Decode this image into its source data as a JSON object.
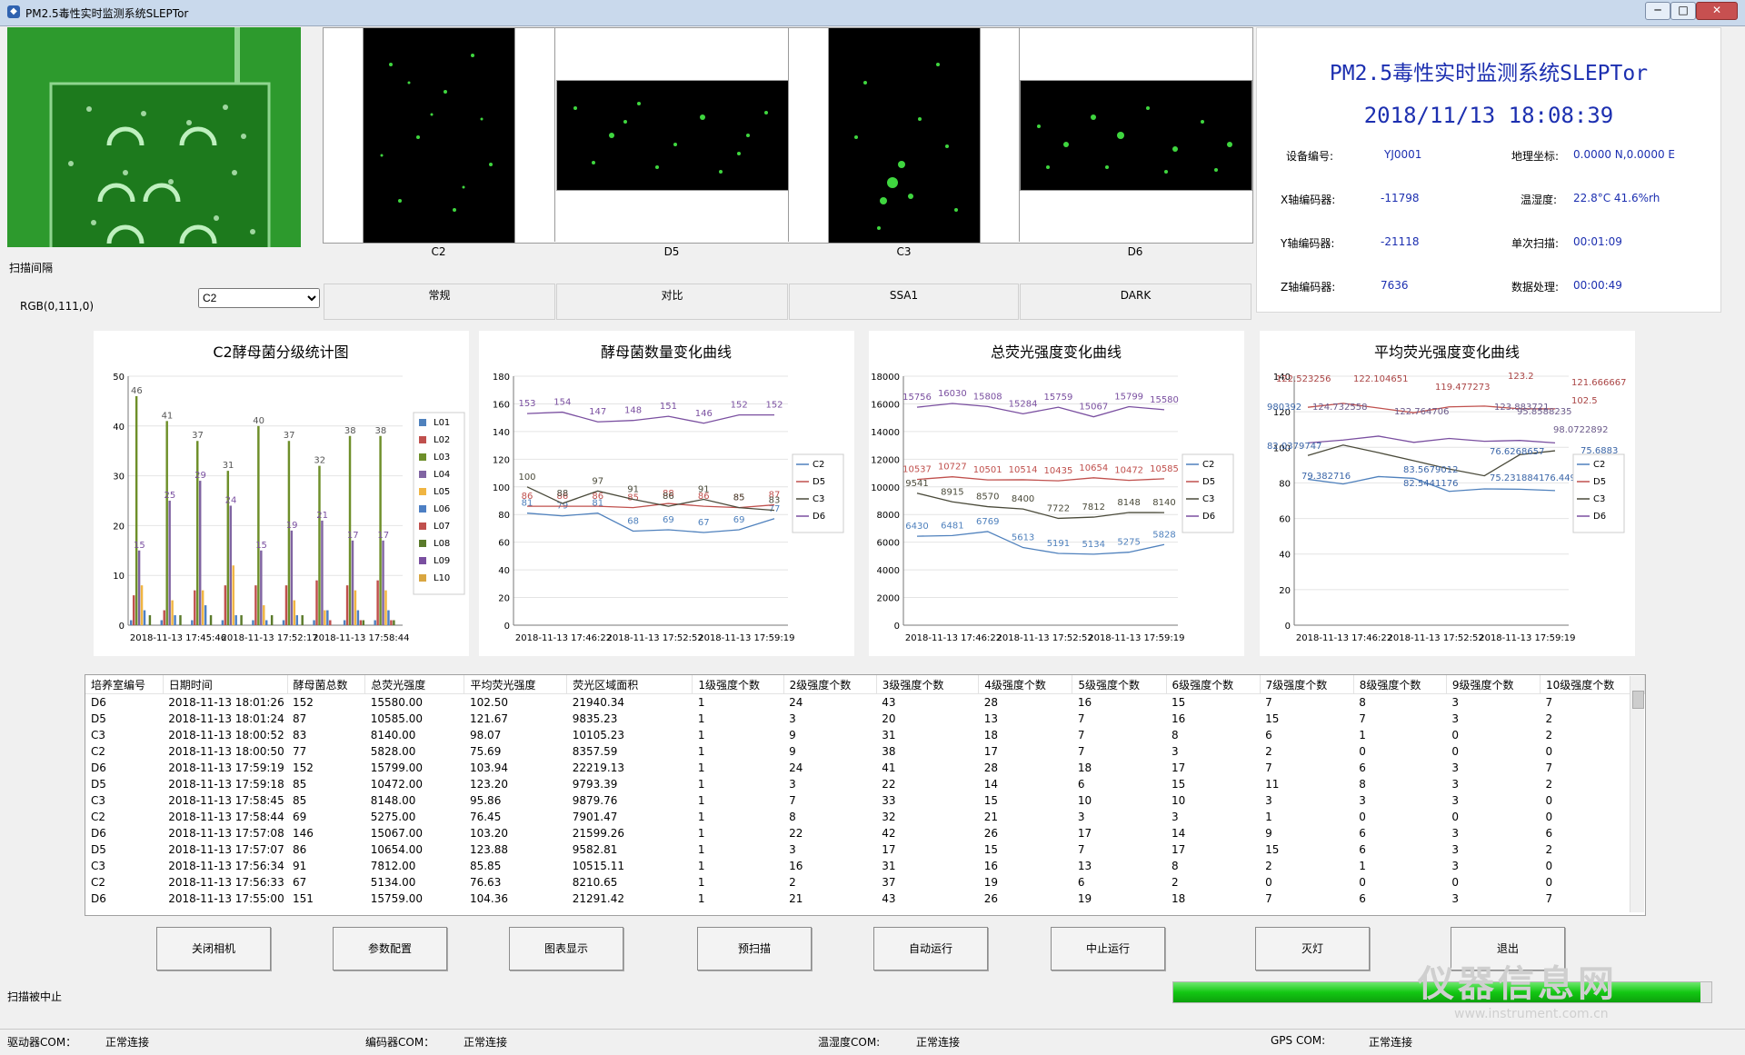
{
  "window": {
    "title": "PM2.5毒性实时监测系统SLEPTor",
    "minimize": "─",
    "maximize": "□",
    "close": "✕"
  },
  "left": {
    "scan_interval_label": "扫描间隔",
    "rgb_label": "RGB(0,111,0)",
    "channel_select": "C2"
  },
  "panels": [
    {
      "caption": "C2"
    },
    {
      "caption": "D5"
    },
    {
      "caption": "C3"
    },
    {
      "caption": "D6"
    }
  ],
  "modes": [
    "常规",
    "对比",
    "SSA1",
    "DARK"
  ],
  "info": {
    "title": "PM2.5毒性实时监测系统SLEPTor",
    "datetime": "2018/11/13  18:08:39",
    "fields": [
      {
        "label": "设备编号:",
        "value": "YJ0001"
      },
      {
        "label": "地理坐标:",
        "value": "0.0000 N,0.0000 E"
      },
      {
        "label": "X轴编码器:",
        "value": "-11798"
      },
      {
        "label": "温湿度:",
        "value": "22.8°C 41.6%rh"
      },
      {
        "label": "Y轴编码器:",
        "value": "-21118"
      },
      {
        "label": "单次扫描:",
        "value": "00:01:09"
      },
      {
        "label": "Z轴编码器:",
        "value": "7636"
      },
      {
        "label": "数据处理:",
        "value": "00:00:49"
      }
    ]
  },
  "chart_data": [
    {
      "type": "bar",
      "title": "C2酵母菌分级统计图",
      "ylim": [
        0,
        50
      ],
      "yticks": [
        0,
        10,
        20,
        30,
        40,
        50
      ],
      "xticklabels": [
        "2018-11-13 17:45:46",
        "2018-11-13 17:52:17",
        "2018-11-13 17:58:44"
      ],
      "legend_position": "right",
      "series": [
        {
          "name": "L01",
          "color": "#4f81bd",
          "values": [
            1,
            1,
            1,
            1,
            1,
            1,
            1,
            1,
            1
          ]
        },
        {
          "name": "L02",
          "color": "#c0504d",
          "values": [
            6,
            3,
            7,
            8,
            8,
            8,
            9,
            8,
            9
          ]
        },
        {
          "name": "L03",
          "color": "#6e8f2a",
          "values": [
            46,
            41,
            37,
            31,
            40,
            37,
            32,
            38,
            38
          ]
        },
        {
          "name": "L04",
          "color": "#8064a2",
          "values": [
            15,
            25,
            29,
            24,
            15,
            19,
            21,
            17,
            17
          ]
        },
        {
          "name": "L05",
          "color": "#f0b542",
          "values": [
            8,
            5,
            7,
            12,
            4,
            5,
            3,
            7,
            7
          ]
        },
        {
          "name": "L06",
          "color": "#4d7fc4",
          "values": [
            3,
            2,
            4,
            2,
            1,
            2,
            3,
            3,
            3
          ]
        },
        {
          "name": "L07",
          "color": "#c0504d",
          "values": [
            0,
            0,
            0,
            0,
            0,
            0,
            1,
            1,
            1
          ]
        },
        {
          "name": "L08",
          "color": "#5a7a2a",
          "values": [
            2,
            2,
            2,
            2,
            2,
            2,
            0,
            1,
            1
          ]
        },
        {
          "name": "L09",
          "color": "#7a4fa0",
          "values": [
            0,
            0,
            0,
            0,
            0,
            0,
            0,
            0,
            0
          ]
        },
        {
          "name": "L10",
          "color": "#d9a640",
          "values": [
            0,
            0,
            0,
            0,
            0,
            0,
            0,
            0,
            0
          ]
        }
      ]
    },
    {
      "type": "line",
      "title": "酵母菌数量变化曲线",
      "ylim": [
        0,
        180
      ],
      "yticks": [
        0,
        20,
        40,
        60,
        80,
        100,
        120,
        140,
        160,
        180
      ],
      "xticklabels": [
        "2018-11-13 17:46:22",
        "2018-11-13 17:52:52",
        "2018-11-13 17:59:19"
      ],
      "legend_position": "right",
      "series": [
        {
          "name": "C2",
          "color": "#4f81bd",
          "values": [
            81,
            79,
            81,
            68,
            69,
            67,
            69,
            77
          ]
        },
        {
          "name": "D5",
          "color": "#c0504d",
          "values": [
            86,
            86,
            86,
            85,
            88,
            86,
            85,
            87
          ]
        },
        {
          "name": "C3",
          "color": "#4a4a3a",
          "values": [
            100,
            88,
            97,
            91,
            86,
            91,
            85,
            83
          ]
        },
        {
          "name": "D6",
          "color": "#7a4fa0",
          "values": [
            153,
            154,
            147,
            148,
            151,
            146,
            152,
            152
          ]
        }
      ]
    },
    {
      "type": "line",
      "title": "总荧光强度变化曲线",
      "ylim": [
        0,
        18000
      ],
      "yticks": [
        0,
        2000,
        4000,
        6000,
        8000,
        10000,
        12000,
        14000,
        16000,
        18000
      ],
      "xticklabels": [
        "2018-11-13 17:46:22",
        "2018-11-13 17:52:52",
        "2018-11-13 17:59:19"
      ],
      "legend_position": "right",
      "series": [
        {
          "name": "C2",
          "color": "#4f81bd",
          "values": [
            6430,
            6481,
            6769,
            5613,
            5191,
            5134,
            5275,
            5828
          ]
        },
        {
          "name": "D5",
          "color": "#c0504d",
          "values": [
            10537,
            10727,
            10501,
            10514,
            10435,
            10654,
            10472,
            10585
          ]
        },
        {
          "name": "C3",
          "color": "#4a4a3a",
          "values": [
            9541,
            8915,
            8570,
            8400,
            7722,
            7812,
            8148,
            8140
          ]
        },
        {
          "name": "D6",
          "color": "#7a4fa0",
          "values": [
            15756,
            16030,
            15808,
            15284,
            15759,
            15067,
            15799,
            15580
          ]
        }
      ]
    },
    {
      "type": "line",
      "title": "平均荧光强度变化曲线",
      "ylim": [
        0,
        140
      ],
      "yticks": [
        0,
        20,
        40,
        60,
        80,
        100,
        120,
        140
      ],
      "xticklabels": [
        "2018-11-13 17:46:22",
        "2018-11-13 17:52:52",
        "2018-11-13 17:59:19"
      ],
      "legend_position": "right",
      "series": [
        {
          "name": "C2",
          "color": "#4f81bd",
          "values": [
            82.0379747,
            79.382716,
            83.5679012,
            82.5441176,
            75.2318841,
            76.6268657,
            76.4492754,
            75.69
          ]
        },
        {
          "name": "D5",
          "color": "#c0504d",
          "values": [
            122.523256,
            124.732558,
            122.104651,
            119.477273,
            122.764706,
            123.2,
            121.666667,
            121.67
          ]
        },
        {
          "name": "C3",
          "color": "#4a4a3a",
          "values": [
            95.41,
            101.3,
            97.0,
            92.5,
            87.8,
            84.0,
            95.8588235,
            98.0722892
          ]
        },
        {
          "name": "D6",
          "color": "#7a4fa0",
          "values": [
            102.5,
            104.1,
            106.3,
            102.8,
            105.0,
            103.4,
            103.88,
            102.5
          ]
        }
      ],
      "labels": [
        "122.523256",
        "122.104651",
        "119.477273",
        "123.2",
        "121.666667",
        "102.5",
        "124.732558",
        "122.764706",
        "123.883721",
        "95.8588235",
        "98.0722892",
        "82.0379747",
        "79.382716",
        "83.5679012",
        "82.5441176",
        "75.2318841",
        "76.6268657",
        "76.4492754",
        "980392",
        "75.6883"
      ]
    }
  ],
  "table": {
    "headers": [
      "培养室编号",
      "日期时间",
      "酵母菌总数",
      "总荧光强度",
      "平均荧光强度",
      "荧光区域面积",
      "1级强度个数",
      "2级强度个数",
      "3级强度个数",
      "4级强度个数",
      "5级强度个数",
      "6级强度个数",
      "7级强度个数",
      "8级强度个数",
      "9级强度个数",
      "10级强度个数"
    ],
    "rows": [
      [
        "D6",
        "2018-11-13 18:01:26",
        "152",
        "15580.00",
        "102.50",
        "21940.34",
        "1",
        "24",
        "43",
        "28",
        "16",
        "15",
        "7",
        "8",
        "3",
        "7"
      ],
      [
        "D5",
        "2018-11-13 18:01:24",
        "87",
        "10585.00",
        "121.67",
        "9835.23",
        "1",
        "3",
        "20",
        "13",
        "7",
        "16",
        "15",
        "7",
        "3",
        "2"
      ],
      [
        "C3",
        "2018-11-13 18:00:52",
        "83",
        "8140.00",
        "98.07",
        "10105.23",
        "1",
        "9",
        "31",
        "18",
        "7",
        "8",
        "6",
        "1",
        "0",
        "2"
      ],
      [
        "C2",
        "2018-11-13 18:00:50",
        "77",
        "5828.00",
        "75.69",
        "8357.59",
        "1",
        "9",
        "38",
        "17",
        "7",
        "3",
        "2",
        "0",
        "0",
        "0"
      ],
      [
        "D6",
        "2018-11-13 17:59:19",
        "152",
        "15799.00",
        "103.94",
        "22219.13",
        "1",
        "24",
        "41",
        "28",
        "18",
        "17",
        "7",
        "6",
        "3",
        "7"
      ],
      [
        "D5",
        "2018-11-13 17:59:18",
        "85",
        "10472.00",
        "123.20",
        "9793.39",
        "1",
        "3",
        "22",
        "14",
        "6",
        "15",
        "11",
        "8",
        "3",
        "2"
      ],
      [
        "C3",
        "2018-11-13 17:58:45",
        "85",
        "8148.00",
        "95.86",
        "9879.76",
        "1",
        "7",
        "33",
        "15",
        "10",
        "10",
        "3",
        "3",
        "3",
        "0"
      ],
      [
        "C2",
        "2018-11-13 17:58:44",
        "69",
        "5275.00",
        "76.45",
        "7901.47",
        "1",
        "8",
        "32",
        "21",
        "3",
        "3",
        "1",
        "0",
        "0",
        "0"
      ],
      [
        "D6",
        "2018-11-13 17:57:08",
        "146",
        "15067.00",
        "103.20",
        "21599.26",
        "1",
        "22",
        "42",
        "26",
        "17",
        "14",
        "9",
        "6",
        "3",
        "6"
      ],
      [
        "D5",
        "2018-11-13 17:57:07",
        "86",
        "10654.00",
        "123.88",
        "9582.81",
        "1",
        "3",
        "17",
        "15",
        "7",
        "17",
        "15",
        "6",
        "3",
        "2"
      ],
      [
        "C3",
        "2018-11-13 17:56:34",
        "91",
        "7812.00",
        "85.85",
        "10515.11",
        "1",
        "16",
        "31",
        "16",
        "13",
        "8",
        "2",
        "1",
        "3",
        "0"
      ],
      [
        "C2",
        "2018-11-13 17:56:33",
        "67",
        "5134.00",
        "76.63",
        "8210.65",
        "1",
        "2",
        "37",
        "19",
        "6",
        "2",
        "0",
        "0",
        "0",
        "0"
      ],
      [
        "D6",
        "2018-11-13 17:55:00",
        "151",
        "15759.00",
        "104.36",
        "21291.42",
        "1",
        "21",
        "43",
        "26",
        "19",
        "18",
        "7",
        "6",
        "3",
        "7"
      ]
    ]
  },
  "actions": [
    "关闭相机",
    "参数配置",
    "图表显示",
    "预扫描",
    "自动运行",
    "中止运行",
    "灭灯",
    "退出"
  ],
  "scan_status": "扫描被中止",
  "progress": 0.98,
  "statusbar": [
    {
      "label": "驱动器COM：",
      "value": "正常连接"
    },
    {
      "label": "编码器COM：",
      "value": "正常连接"
    },
    {
      "label": "温湿度COM:",
      "value": "正常连接"
    },
    {
      "label": "GPS COM:",
      "value": "正常连接"
    }
  ],
  "watermark": {
    "cn": "仪器信息网",
    "url": "www.instrument.com.cn"
  }
}
